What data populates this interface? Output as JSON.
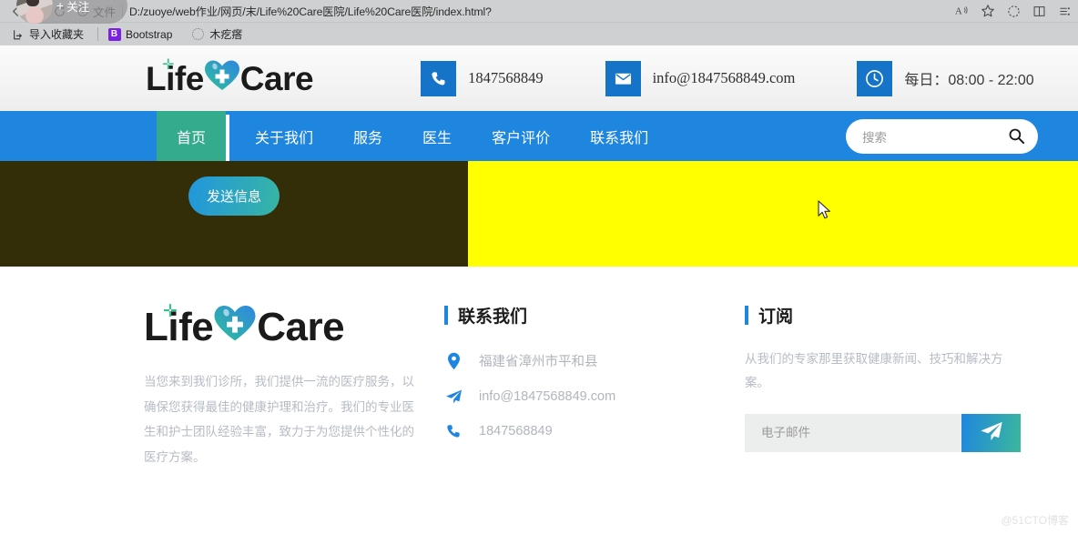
{
  "browser": {
    "back_icon": "back-arrow-icon",
    "forward_icon": "forward-arrow-icon",
    "refresh_icon": "refresh-icon",
    "file_label": "文件",
    "url": "D:/zuoye/web作业/网页/末/Life%20Care医院/Life%20Care医院/index.html?",
    "follow_label": "关注",
    "follow_plus": "+",
    "toolbar_icons": [
      {
        "name": "read-aloud-icon",
        "glyph": "A"
      },
      {
        "name": "favorite-star-icon",
        "glyph": "☆"
      },
      {
        "name": "collections-icon",
        "glyph": "◌"
      },
      {
        "name": "split-screen-icon",
        "glyph": "⫿"
      },
      {
        "name": "browser-settings-icon",
        "glyph": "⋮"
      }
    ],
    "bookmarks": [
      {
        "name": "import-favorites",
        "label": "导入收藏夹",
        "icon": "import-icon"
      },
      {
        "name": "bootstrap",
        "label": "Bootstrap",
        "icon": "bootstrap-badge",
        "badge": "B"
      },
      {
        "name": "mugeda",
        "label": "木疙瘩",
        "icon": "loading-spinner-icon"
      }
    ]
  },
  "header": {
    "logo": {
      "part1": "Life",
      "part2": "Care",
      "icon": "heart-cross-icon"
    },
    "contacts": [
      {
        "name": "phone",
        "icon": "phone-icon",
        "value": "1847568849"
      },
      {
        "name": "email",
        "icon": "envelope-icon",
        "value": "info@1847568849.com"
      },
      {
        "name": "hours",
        "icon": "clock-icon",
        "value": "每日：08:00 - 22:00"
      }
    ]
  },
  "nav": {
    "items": [
      {
        "name": "home",
        "label": "首页",
        "active": true
      },
      {
        "name": "about",
        "label": "关于我们",
        "active": false
      },
      {
        "name": "services",
        "label": "服务",
        "active": false
      },
      {
        "name": "doctors",
        "label": "医生",
        "active": false
      },
      {
        "name": "testimonials",
        "label": "客户评价",
        "active": false
      },
      {
        "name": "contact",
        "label": "联系我们",
        "active": false
      }
    ],
    "search": {
      "placeholder": "搜索",
      "icon": "search-icon"
    }
  },
  "band": {
    "send_button": "发送信息",
    "dark_color": "#332d08",
    "yellow_color": "#ffff00"
  },
  "footer": {
    "logo": {
      "part1": "Life",
      "part2": "Care",
      "icon": "heart-cross-icon"
    },
    "description": "当您来到我们诊所，我们提供一流的医疗服务，以确保您获得最佳的健康护理和治疗。我们的专业医生和护士团队经验丰富，致力于为您提供个性化的医疗方案。",
    "contact": {
      "title": "联系我们",
      "items": [
        {
          "name": "address",
          "icon": "location-pin-icon",
          "value": "福建省漳州市平和县"
        },
        {
          "name": "email",
          "icon": "paper-plane-icon",
          "value": "info@1847568849.com"
        },
        {
          "name": "phone",
          "icon": "phone-icon",
          "value": "1847568849"
        }
      ]
    },
    "subscribe": {
      "title": "订阅",
      "description": "从我们的专家那里获取健康新闻、技巧和解决方案。",
      "input_placeholder": "电子邮件",
      "input_value": "",
      "submit_icon": "paper-plane-icon"
    },
    "watermark": "@51CTO博客"
  },
  "colors": {
    "nav_blue": "#1f86e0",
    "active_teal": "#35ab8d",
    "accent_blue": "#1574c8",
    "gradient_start": "#1f86e0",
    "gradient_end": "#3bb89b"
  }
}
